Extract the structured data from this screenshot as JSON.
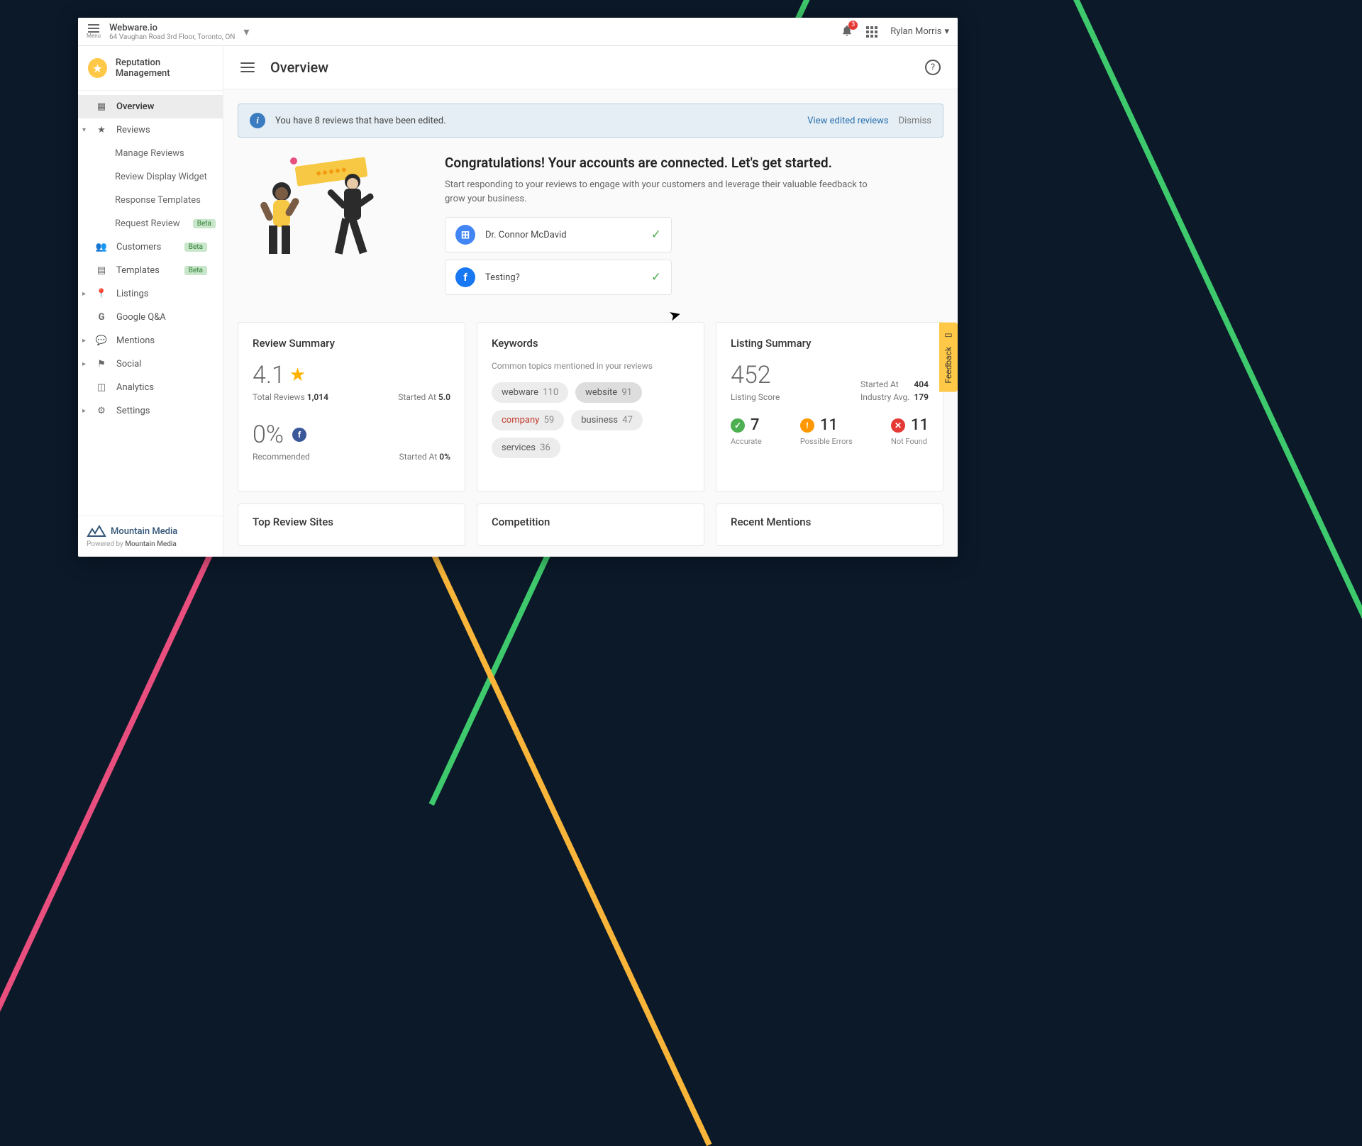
{
  "topbar": {
    "menu": "Menu",
    "company": "Webware.io",
    "address": "64 Vaughan Road 3rd Floor, Toronto, ON",
    "notif_count": "3",
    "user": "Rylan Morris"
  },
  "sidebar": {
    "product": "Reputation Management",
    "items": {
      "overview": "Overview",
      "reviews": "Reviews",
      "manage": "Manage Reviews",
      "widget": "Review Display Widget",
      "templates": "Response Templates",
      "request": "Request Review",
      "customers": "Customers",
      "tmpl": "Templates",
      "listings": "Listings",
      "gqa": "Google Q&A",
      "mentions": "Mentions",
      "social": "Social",
      "analytics": "Analytics",
      "settings": "Settings"
    },
    "beta": "Beta",
    "footer_logo": "Mountain Media",
    "powered_prefix": "Powered by ",
    "powered_name": "Mountain Media"
  },
  "header": {
    "title": "Overview"
  },
  "alert": {
    "text": "You have 8 reviews that have been edited.",
    "view": "View edited reviews",
    "dismiss": "Dismiss"
  },
  "hero": {
    "title": "Congratulations! Your accounts are connected. Let's get started.",
    "sub": "Start responding to your reviews to engage with your customers and leverage their valuable feedback to grow your business.",
    "accounts": [
      {
        "name": "Dr. Connor McDavid"
      },
      {
        "name": "Testing?"
      }
    ]
  },
  "review_summary": {
    "title": "Review Summary",
    "rating": "4.1",
    "total_label": "Total Reviews",
    "total": "1,014",
    "started_label": "Started At",
    "started": "5.0",
    "pct": "0%",
    "rec_label": "Recommended",
    "pct_started": "0%"
  },
  "keywords": {
    "title": "Keywords",
    "sub": "Common topics mentioned in your reviews",
    "list": [
      {
        "w": "webware",
        "c": "110"
      },
      {
        "w": "website",
        "c": "91"
      },
      {
        "w": "company",
        "c": "59"
      },
      {
        "w": "business",
        "c": "47"
      },
      {
        "w": "services",
        "c": "36"
      }
    ]
  },
  "listing": {
    "title": "Listing Summary",
    "score": "452",
    "score_label": "Listing Score",
    "started_label": "Started At",
    "started": "404",
    "avg_label": "Industry Avg.",
    "avg": "179",
    "accurate": {
      "n": "7",
      "l": "Accurate"
    },
    "possible": {
      "n": "11",
      "l": "Possible Errors"
    },
    "notfound": {
      "n": "11",
      "l": "Not Found"
    }
  },
  "bottom": {
    "top_sites": "Top Review Sites",
    "competition": "Competition",
    "mentions": "Recent Mentions"
  },
  "feedback": "Feedback"
}
